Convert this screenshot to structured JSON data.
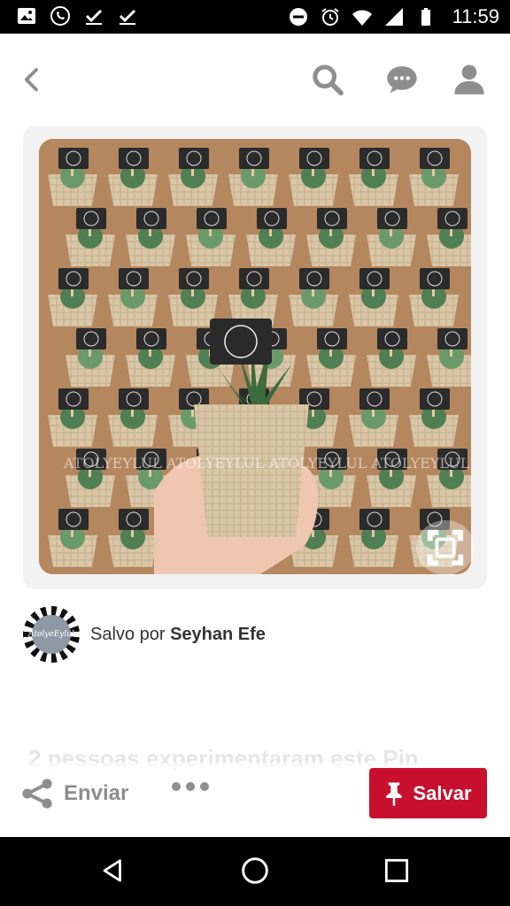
{
  "status_bar": {
    "time": "11:59",
    "left_icons": [
      "image-icon",
      "whatsapp-icon",
      "download-done-icon",
      "download-done-icon"
    ],
    "right_icons": [
      "do-not-disturb-icon",
      "alarm-icon",
      "wifi-icon",
      "signal-icon",
      "battery-icon"
    ]
  },
  "nav": {
    "icons": [
      "back-icon",
      "search-icon",
      "messages-icon",
      "profile-icon"
    ]
  },
  "pin": {
    "image_alt": "",
    "watermark": "ATOLYEYLUL ATOLYEYLUL ATOLYEYLUL ATOLYEYLUL"
  },
  "saved_by": {
    "prefix": "Salvo por",
    "user": "Seyhan Efe",
    "avatar_text": "AtolyeEylul"
  },
  "faded_text": "2 pessoas experimentaram este Pin",
  "actions": {
    "share_label": "Enviar",
    "save_label": "Salvar"
  },
  "colors": {
    "save_red": "#c8102e",
    "icon_gray": "#8e8e8e"
  }
}
